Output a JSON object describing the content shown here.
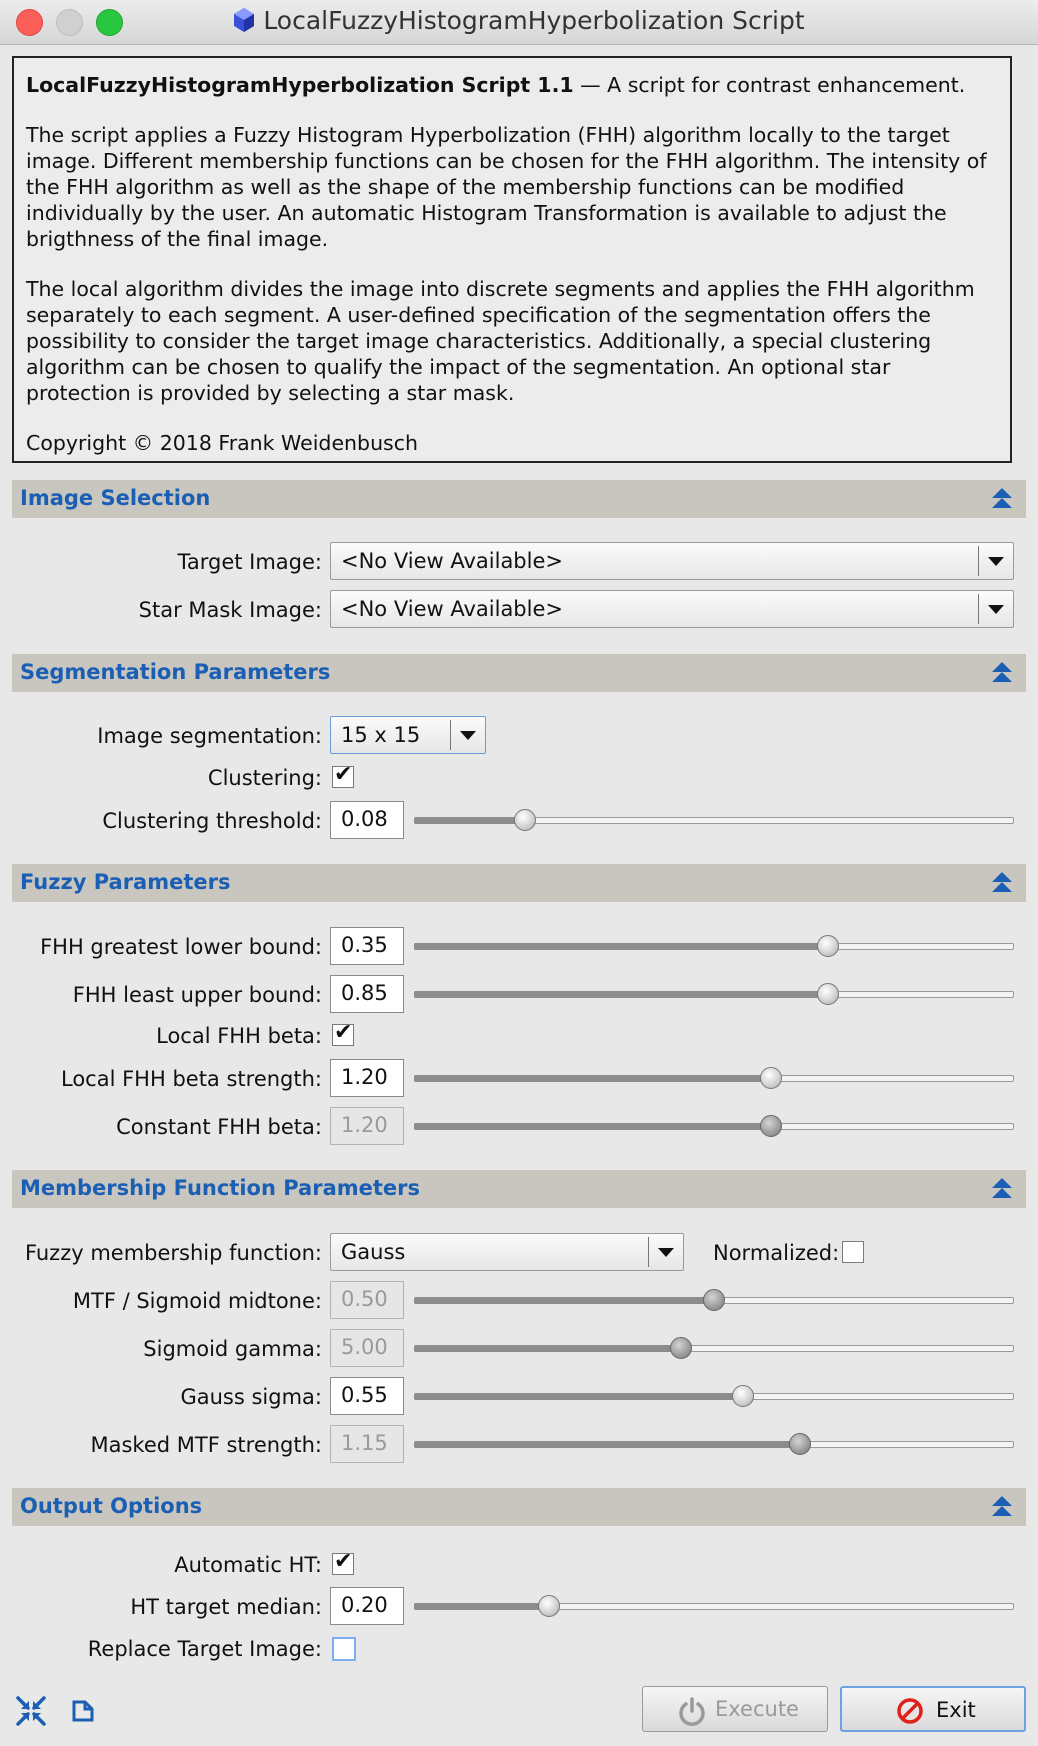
{
  "window": {
    "title": "LocalFuzzyHistogramHyperbolization Script"
  },
  "info": {
    "heading": "LocalFuzzyHistogramHyperbolization Script 1.1",
    "heading_suffix": " — A script for contrast enhancement.",
    "para1": "The script applies a Fuzzy Histogram Hyperbolization (FHH) algorithm locally to the target image. Different membership functions can be chosen for the FHH algorithm. The intensity of the FHH algorithm as well as the shape of the membership functions can be modified individually by the user. An automatic Histogram Transformation is available to adjust the brigthness of the final image.",
    "para2": "The local algorithm divides the image into discrete segments and applies the FHH algorithm separately to each segment. A user-defined specification of the segmentation offers the possibility to consider the target image characteristics. Additionally, a special clustering algorithm can be chosen to qualify the impact of the segmentation. An optional star protection is provided by selecting a star mask.",
    "copyright": "Copyright © 2018 Frank Weidenbusch"
  },
  "image_selection": {
    "title": "Image Selection",
    "target_label": "Target Image:",
    "target_value": "<No View Available>",
    "mask_label": "Star Mask Image:",
    "mask_value": "<No View Available>"
  },
  "segmentation": {
    "title": "Segmentation Parameters",
    "seg_label": "Image segmentation:",
    "seg_value": "15 x 15",
    "clustering_label": "Clustering:",
    "clustering_checked": true,
    "threshold_label": "Clustering threshold:",
    "threshold_value": "0.08",
    "threshold_fraction": 0.185
  },
  "fuzzy": {
    "title": "Fuzzy Parameters",
    "glb_label": "FHH greatest lower bound:",
    "glb_value": "0.35",
    "lub_label": "FHH least upper bound:",
    "lub_value": "0.85",
    "local_beta_label": "Local FHH beta:",
    "local_beta_checked": true,
    "beta_strength_label": "Local FHH beta strength:",
    "beta_strength_value": "1.20",
    "const_beta_label": "Constant FHH beta:",
    "const_beta_value": "1.20"
  },
  "membership": {
    "title": "Membership Function Parameters",
    "func_label": "Fuzzy membership function:",
    "func_value": "Gauss",
    "normalized_label": "Normalized:",
    "normalized_checked": false,
    "mtf_label": "MTF / Sigmoid midtone:",
    "mtf_value": "0.50",
    "gamma_label": "Sigmoid gamma:",
    "gamma_value": "5.00",
    "sigma_label": "Gauss sigma:",
    "sigma_value": "0.55",
    "masked_label": "Masked MTF strength:",
    "masked_value": "1.15"
  },
  "output": {
    "title": "Output Options",
    "auto_ht_label": "Automatic HT:",
    "auto_ht_checked": true,
    "median_label": "HT target median:",
    "median_value": "0.20",
    "replace_label": "Replace Target Image:",
    "replace_checked": false
  },
  "buttons": {
    "execute": "Execute",
    "exit": "Exit"
  },
  "icons": {
    "app": "pixinsight-cube-icon",
    "collapse": "double-chevron-up-icon",
    "reset": "reset-arrows-icon",
    "new_instance": "new-instance-icon",
    "power": "power-icon",
    "stop": "stop-sign-icon"
  },
  "colors": {
    "section_title": "#1a5fb4",
    "section_bg": "#c8c6bf",
    "stop_red": "#e0201a"
  }
}
